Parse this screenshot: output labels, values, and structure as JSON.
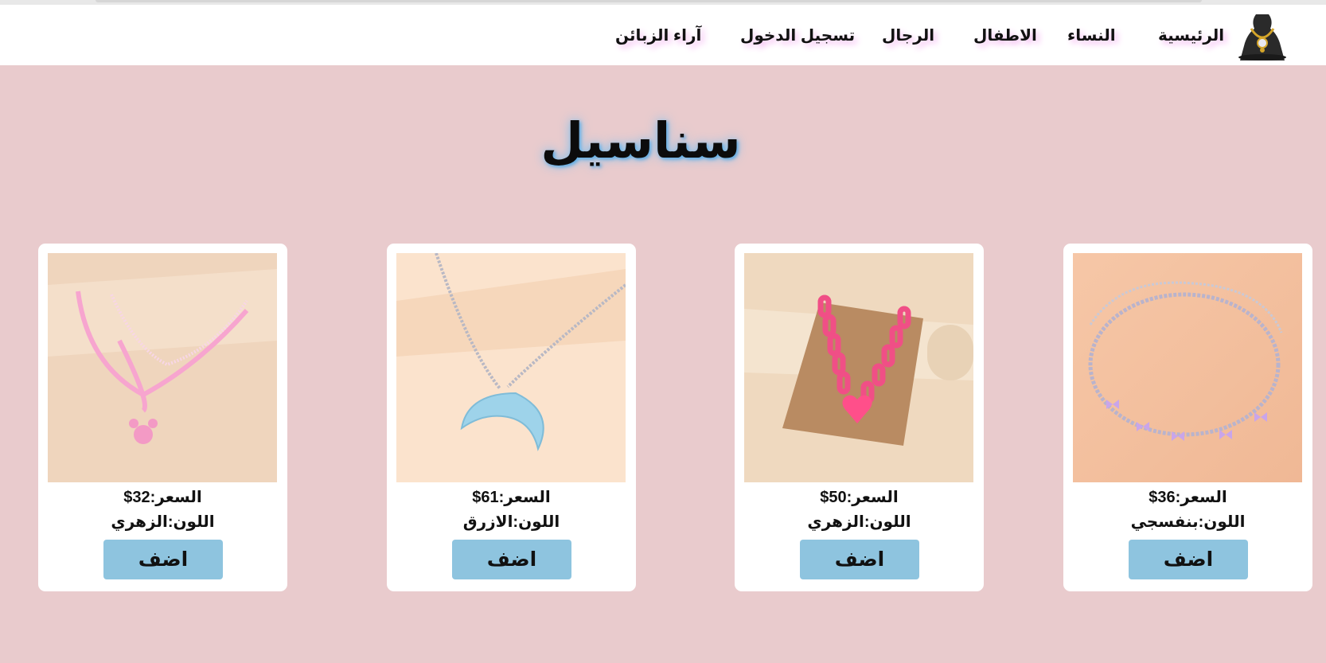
{
  "nav": {
    "logo_icon": "necklace-logo-icon",
    "items": [
      {
        "label": "الرئيسية"
      },
      {
        "label": "النساء"
      },
      {
        "label": "الاطفال"
      },
      {
        "label": "الرجال"
      },
      {
        "label": "تسجيل الدخول"
      },
      {
        "label": "آراء الزبائن"
      }
    ]
  },
  "page": {
    "title": "سناسيل",
    "background_color": "#e9cbcd"
  },
  "products": [
    {
      "price": "السعر:36$",
      "color": "اللون:بنفسجي",
      "button": "اضف",
      "image_icon": "silver-butterfly-necklace-image"
    },
    {
      "price": "السعر:50$",
      "color": "اللون:الزهري",
      "button": "اضف",
      "image_icon": "pink-chain-heart-necklace-image"
    },
    {
      "price": "السعر:61$",
      "color": "اللون:الازرق",
      "button": "اضف",
      "image_icon": "blue-moon-necklace-image"
    },
    {
      "price": "السعر:32$",
      "color": "اللون:الزهري",
      "button": "اضف",
      "image_icon": "pink-layered-bear-necklace-image"
    }
  ],
  "colors": {
    "button": "#8ec4df",
    "nav_glow": "#f3b3f0",
    "title_glow": "#78c0f0"
  }
}
